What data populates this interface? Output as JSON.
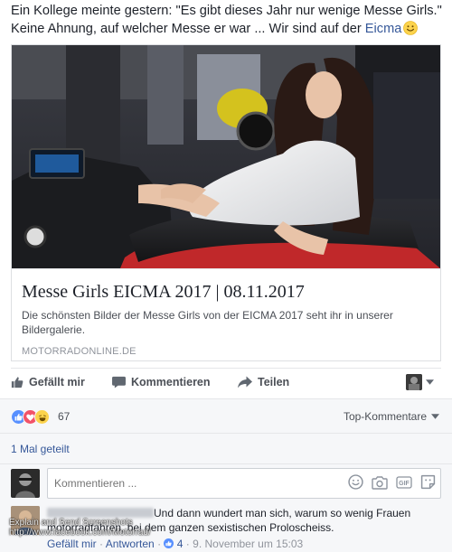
{
  "post": {
    "text_line1": "Ein Kollege meinte gestern: \"Es gibt dieses Jahr nur wenige Messe Girls.\"",
    "text_line2_prefix": "Keine Ahnung, auf welcher Messe er war ... Wir sind auf der ",
    "text_link": "Eicma",
    "emoji": "smile-emoji"
  },
  "link_card": {
    "title": "Messe Girls EICMA 2017 | 08.11.2017",
    "description": "Die schönsten Bilder der Messe Girls von der EICMA 2017 seht ihr in unserer Bildergalerie.",
    "domain": "MOTORRADONLINE.DE"
  },
  "actions": {
    "like": "Gefällt mir",
    "comment": "Kommentieren",
    "share": "Teilen"
  },
  "reactions": {
    "count": "67",
    "types": [
      "like",
      "love",
      "haha"
    ],
    "sort_label": "Top-Kommentare"
  },
  "shares": {
    "label": "1 Mal geteilt"
  },
  "comment_box": {
    "placeholder": "Kommentieren ..."
  },
  "comment": {
    "text_line1": "Und dann wundert man sich, warum so wenig Frauen",
    "text_line2": "motorradfahren, bei dem ganzen sexistischen Proloscheiss.",
    "like": "Gefällt mir",
    "reply": "Antworten",
    "reaction_count": "4",
    "time": "9. November um 15:03"
  },
  "watermark": {
    "line1": "Explain and Send Screenshots",
    "line2": "http://www.facebook.com/Motorrad/"
  },
  "colors": {
    "link": "#365899",
    "text": "#1d2129",
    "muted": "#90949c",
    "bar_bg": "#f6f7f9",
    "like_blue": "#5890ff",
    "love_red": "#f25268",
    "haha_yellow": "#fcd34d"
  }
}
